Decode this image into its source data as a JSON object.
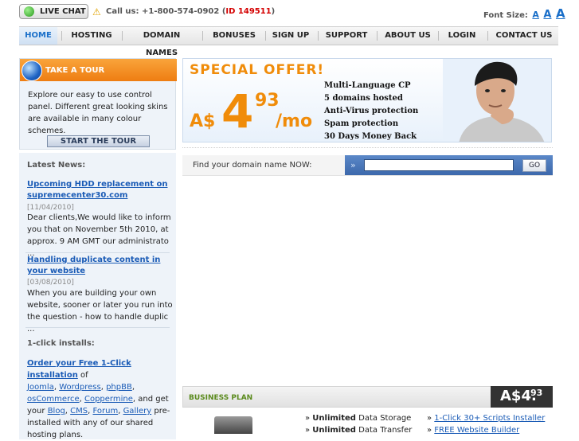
{
  "top": {
    "live_chat": "LIVE CHAT",
    "call_prefix": "Call us: +1-800-574-0902 (",
    "call_id": "ID 149511",
    "call_suffix": ")",
    "font_size_label": "Font Size:",
    "font_a": "A"
  },
  "nav": {
    "items": [
      "HOME",
      "HOSTING",
      "DOMAIN NAMES",
      "BONUSES",
      "SIGN UP",
      "SUPPORT",
      "ABOUT US",
      "LOGIN",
      "CONTACT US"
    ]
  },
  "tour": {
    "title": "TAKE A TOUR",
    "text": "Explore our easy to use control panel. Different great looking skins are available in many colour schemes.",
    "button": "START THE TOUR"
  },
  "news": {
    "title": "Latest News:",
    "items": [
      {
        "link": "Upcoming HDD replacement on supremecenter30.com",
        "date": "[11/04/2010]",
        "text": "Dear clients,We would like to inform you that on November 5th 2010, at approx. 9 AM GMT our administrato ..."
      },
      {
        "link": "Handling duplicate content in your website",
        "date": "[03/08/2010]",
        "text": "When you are building your own website, sooner or later you run into the question - how to handle duplic ..."
      }
    ]
  },
  "install": {
    "title": "1-click installs:",
    "lead": "Order your Free 1-Click installation",
    "of": " of",
    "apps1": [
      "Joomla",
      "Wordpress",
      "phpBB"
    ],
    "apps2": [
      "osCommerce",
      "Coppermine"
    ],
    "and_get": ", and get your",
    "apps3": [
      "Blog",
      "CMS",
      "Forum",
      "Gallery"
    ],
    "tail": "pre-installed with any of our shared hosting plans."
  },
  "offer": {
    "title": "SPECIAL  OFFER!",
    "currency": "A$",
    "price_int": "4",
    "price_dec": "93",
    "per": "/mo",
    "features": [
      "Multi-Language CP",
      "5 domains hosted",
      "Anti-Virus protection",
      "Spam protection",
      "30 Days Money Back"
    ]
  },
  "domain": {
    "label": "Find your domain name NOW:",
    "input_value": "",
    "go": "GO"
  },
  "business": {
    "title": "BUSINESS PLAN",
    "price_main": "A$4.",
    "price_dec": "93",
    "features_left": [
      {
        "bold": "Unlimited",
        "rest": " Data Storage"
      },
      {
        "bold": "Unlimited",
        "rest": " Data Transfer"
      }
    ],
    "features_right": [
      "1-Click 30+ Scripts Installer",
      "FREE Website Builder"
    ]
  }
}
